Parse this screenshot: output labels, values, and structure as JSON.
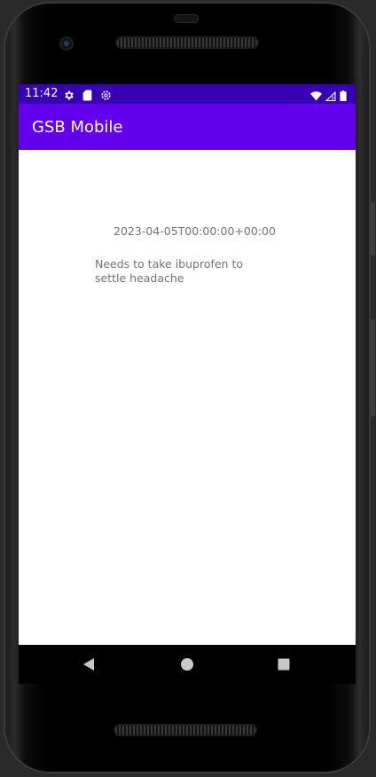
{
  "status_bar": {
    "time": "11:42",
    "left_icons": [
      "gear-icon",
      "sd-card-icon",
      "settings-cog-icon"
    ],
    "right_icons": [
      "wifi-icon",
      "signal-icon",
      "battery-icon"
    ],
    "color": "#3700b3"
  },
  "app_bar": {
    "title": "GSB Mobile",
    "color": "#6200ee"
  },
  "content": {
    "date": "2023-04-05T00:00:00+00:00",
    "note": "Needs to take ibuprofen to settle headache"
  },
  "navigation": {
    "back_icon": "back-triangle-icon",
    "home_icon": "home-circle-icon",
    "recents_icon": "recents-square-icon"
  }
}
